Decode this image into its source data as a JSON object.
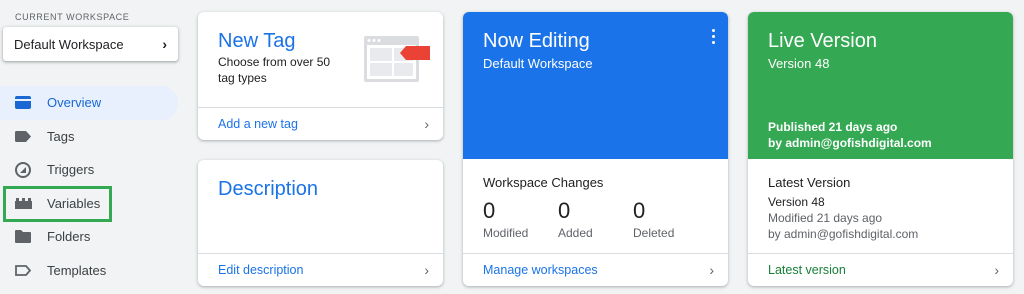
{
  "sidebar": {
    "workspace_label": "CURRENT WORKSPACE",
    "workspace_name": "Default Workspace",
    "items": [
      {
        "label": "Overview",
        "icon": "overview-icon",
        "active": true
      },
      {
        "label": "Tags",
        "icon": "tag-icon"
      },
      {
        "label": "Triggers",
        "icon": "trigger-icon"
      },
      {
        "label": "Variables",
        "icon": "variables-icon"
      },
      {
        "label": "Folders",
        "icon": "folder-icon"
      },
      {
        "label": "Templates",
        "icon": "template-icon"
      }
    ]
  },
  "new_tag": {
    "title": "New Tag",
    "description": "Choose from over 50 tag types",
    "footer": "Add a new tag"
  },
  "description_card": {
    "title": "Description",
    "footer": "Edit description"
  },
  "now_editing": {
    "title": "Now Editing",
    "workspace": "Default Workspace",
    "changes_title": "Workspace Changes",
    "stats": [
      {
        "value": "0",
        "label": "Modified"
      },
      {
        "value": "0",
        "label": "Added"
      },
      {
        "value": "0",
        "label": "Deleted"
      }
    ],
    "footer": "Manage workspaces"
  },
  "live_version": {
    "title": "Live Version",
    "version": "Version 48",
    "published": "Published 21 days ago",
    "published_by": "by admin@gofishdigital.com",
    "latest_title": "Latest Version",
    "latest_version": "Version 48",
    "latest_modified": "Modified 21 days ago",
    "latest_by": "by admin@gofishdigital.com",
    "footer": "Latest version"
  },
  "colors": {
    "accent_blue": "#1a73e8",
    "live_green": "#34a853",
    "highlight_green": "#34a853",
    "tag_red": "#ea4335"
  }
}
